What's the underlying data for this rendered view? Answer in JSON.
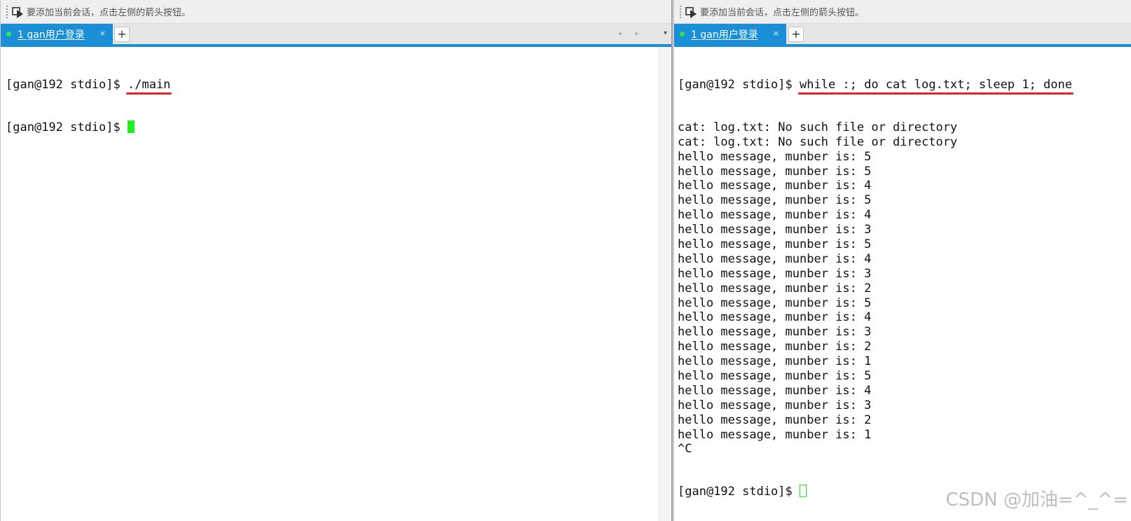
{
  "hint_text": "要添加当前会话，点击左侧的箭头按钮。",
  "left": {
    "tab": {
      "label": "1 gan用户登录",
      "close": "×"
    },
    "add_tab": "+",
    "nav_arrows": "◂ ▸",
    "nav_menu": "▾",
    "prompt": "[gan@192 stdio]$ ",
    "lines": [
      {
        "prompt": "[gan@192 stdio]$ ",
        "command": "./main"
      },
      {
        "prompt": "[gan@192 stdio]$ "
      }
    ]
  },
  "right": {
    "tab": {
      "label": "1 gan用户登录",
      "close": "×"
    },
    "add_tab": "+",
    "command_prompt": "[gan@192 stdio]$ ",
    "command": "while :; do cat log.txt; sleep 1; done",
    "output": [
      "cat: log.txt: No such file or directory",
      "cat: log.txt: No such file or directory",
      "hello message, munber is: 5",
      "hello message, munber is: 5",
      "hello message, munber is: 4",
      "hello message, munber is: 5",
      "hello message, munber is: 4",
      "hello message, munber is: 3",
      "hello message, munber is: 5",
      "hello message, munber is: 4",
      "hello message, munber is: 3",
      "hello message, munber is: 2",
      "hello message, munber is: 5",
      "hello message, munber is: 4",
      "hello message, munber is: 3",
      "hello message, munber is: 2",
      "hello message, munber is: 1",
      "hello message, munber is: 5",
      "hello message, munber is: 4",
      "hello message, munber is: 3",
      "hello message, munber is: 2",
      "hello message, munber is: 1",
      "^C"
    ],
    "final_prompt": "[gan@192 stdio]$ "
  },
  "watermark": "CSDN @加油=^_^=",
  "colors": {
    "tab_active": "#1a8fd8",
    "cursor": "#22ee22",
    "annotation_underline": "#e0232f"
  }
}
